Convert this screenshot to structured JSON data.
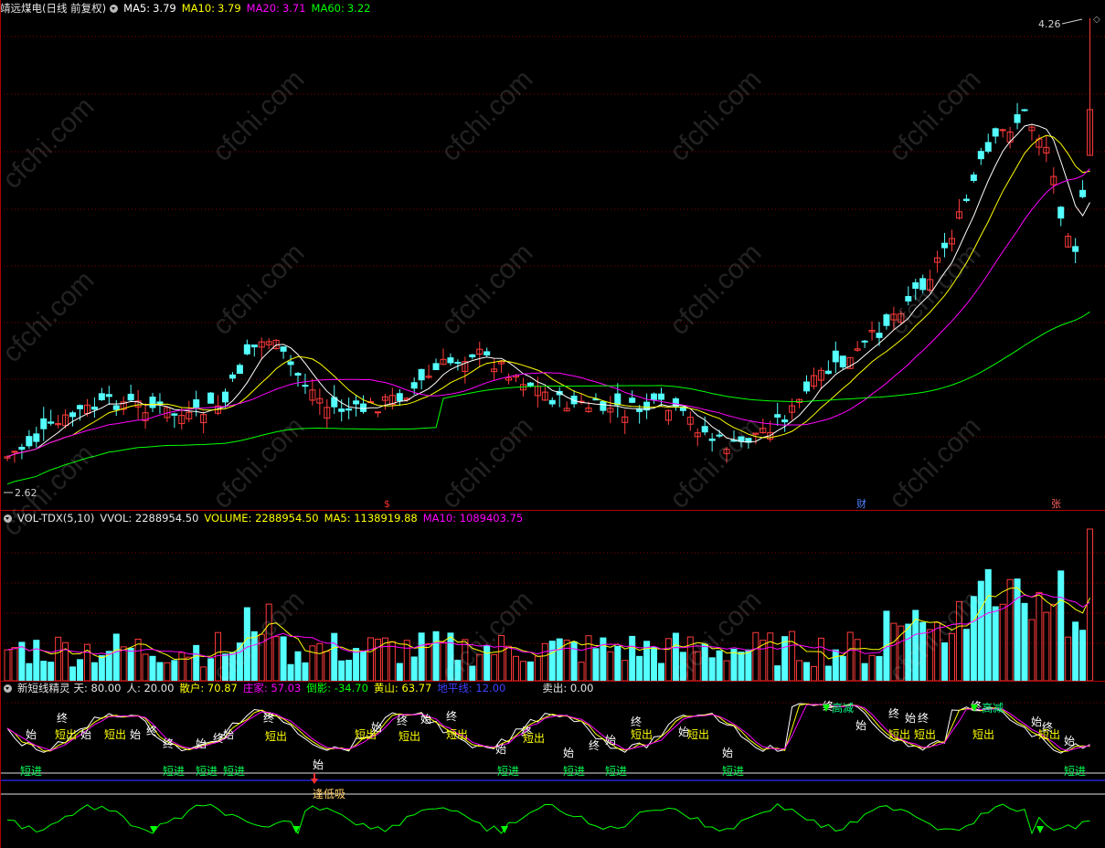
{
  "main_header": {
    "title": "靖远煤电",
    "period": "(日线 前复权)",
    "ma5_label": "MA5:",
    "ma5_value": "3.79",
    "ma10_label": "MA10:",
    "ma10_value": "3.79",
    "ma20_label": "MA20:",
    "ma20_value": "3.71",
    "ma60_label": "MA60:",
    "ma60_value": "3.22"
  },
  "price_high_label": "4.26",
  "price_low_label": "2.62",
  "event_markers": [
    "$",
    "财",
    "张"
  ],
  "vol_header": {
    "name": "VOL-TDX(5,10)",
    "vvol": "VVOL: 2288954.50",
    "volume": "VOLUME: 2288954.50",
    "ma5": "MA5: 1138919.88",
    "ma10": "MA10: 1089403.75"
  },
  "ind_header": {
    "name": "新短线精灵",
    "tian": "天: 80.00",
    "ren": "人: 20.00",
    "sanhu": "散户: 70.87",
    "zhuangjia": "庄家: 57.03",
    "daoying": "倒影: -34.70",
    "huangshan": "黄山: 63.77",
    "dipingxian": "地平线: 12.00",
    "maichu": "卖出: 0.00"
  },
  "ind_labels": {
    "shi": "始",
    "zhong": "终",
    "duanchu": "短出",
    "duanjin": "短进",
    "gaojian": "高减",
    "fengdixi": "逢低吸"
  },
  "watermark": "cfchi.com",
  "colors": {
    "up": "#ff3b3b",
    "down": "#54ffff",
    "ma5": "#ffffff",
    "ma10": "#ffff00",
    "ma20": "#ff00ff",
    "ma60": "#00ff00",
    "grid": "#8a0000",
    "blue": "#2a2aff"
  }
}
